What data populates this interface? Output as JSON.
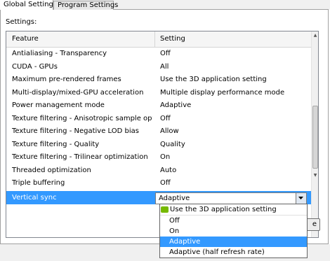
{
  "tabs": [
    {
      "label": "Global Settings",
      "active": true
    },
    {
      "label": "Program Settings",
      "active": false
    }
  ],
  "settings_label": "Settings:",
  "table": {
    "columns": [
      "Feature",
      "Setting"
    ],
    "rows": [
      {
        "feature": "Antialiasing - Transparency",
        "setting": "Off"
      },
      {
        "feature": "CUDA - GPUs",
        "setting": "All"
      },
      {
        "feature": "Maximum pre-rendered frames",
        "setting": "Use the 3D application setting"
      },
      {
        "feature": "Multi-display/mixed-GPU acceleration",
        "setting": "Multiple display performance mode"
      },
      {
        "feature": "Power management mode",
        "setting": "Adaptive"
      },
      {
        "feature": "Texture filtering - Anisotropic sample opti...",
        "setting": "Off"
      },
      {
        "feature": "Texture filtering - Negative LOD bias",
        "setting": "Allow"
      },
      {
        "feature": "Texture filtering - Quality",
        "setting": "Quality"
      },
      {
        "feature": "Texture filtering - Trilinear optimization",
        "setting": "On"
      },
      {
        "feature": "Threaded optimization",
        "setting": "Auto"
      },
      {
        "feature": "Triple buffering",
        "setting": "Off"
      },
      {
        "feature": "Vertical sync",
        "setting": "Adaptive",
        "selected": true
      }
    ]
  },
  "combo": {
    "value": "Adaptive"
  },
  "dropdown": {
    "options": [
      "Use the 3D application setting",
      "Off",
      "On",
      "Adaptive",
      "Adaptive (half refresh rate)"
    ],
    "highlighted_index": 3
  },
  "hidden_button_fragment": "e",
  "colors": {
    "selection": "#3399ff",
    "nvidia_icon": "#76b900"
  }
}
